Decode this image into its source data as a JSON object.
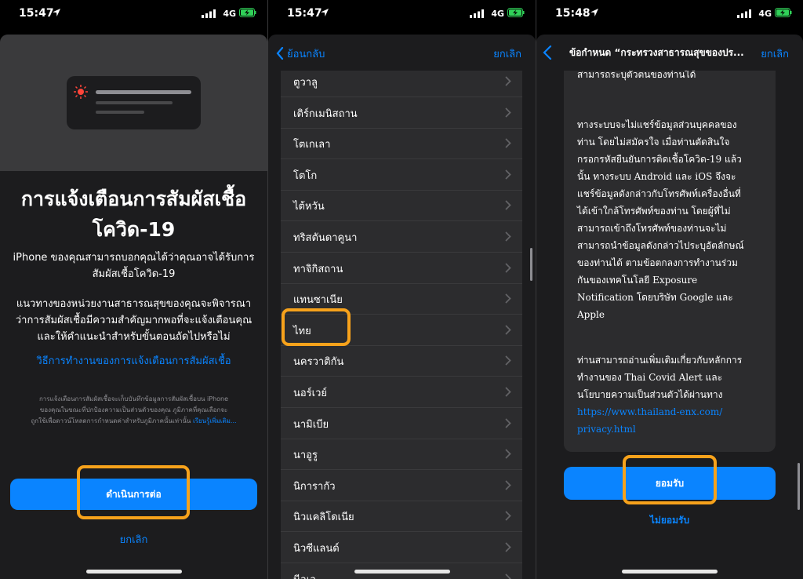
{
  "status": [
    {
      "time": "15:47",
      "network": "4G"
    },
    {
      "time": "15:47",
      "network": "4G"
    },
    {
      "time": "15:48",
      "network": "4G"
    }
  ],
  "panel1": {
    "title_line1": "การแจ้งเตือนการสัมผัสเชื้อ",
    "title_line2": "โควิด-19",
    "sub_line1": "iPhone ของคุณสามารถบอกคุณได้ว่าคุณอาจได้รับการ",
    "sub_line2": "สัมผัสเชื้อโควิด-19",
    "desc_line1": "แนวทางของหน่วยงานสาธารณสุขของคุณจะพิจารณา",
    "desc_line2": "ว่าการสัมผัสเชื้อมีความสำคัญมากพอที่จะแจ้งเตือนคุณ",
    "desc_line3": "และให้คำแนะนำสำหรับขั้นตอนถัดไปหรือไม่",
    "how_link": "วิธีการทำงานของการแจ้งเตือนการสัมผัสเชื้อ",
    "fine_line1": "การแจ้งเตือนการสัมผัสเชื้อจะเก็บบันทึกข้อมูลการสัมผัสเชื้อบน iPhone",
    "fine_line2": "ของคุณในขณะที่ปกป้องความเป็นส่วนตัวของคุณ ภูมิภาคที่คุณเลือกจะ",
    "fine_line3": "ถูกใช้เพื่อดาวน์โหลดการกำหนดค่าสำหรับภูมิภาคนั้นเท่านั้น",
    "fine_more": "เรียนรู้เพิ่มเติม...",
    "continue_button": "ดำเนินการต่อ",
    "cancel": "ยกเลิก"
  },
  "panel2": {
    "back": "ย้อนกลับ",
    "cancel": "ยกเลิก",
    "countries": [
      "ตูวาลู",
      "เติร์กเมนิสถาน",
      "โตเกเลา",
      "โตโก",
      "ไต้หวัน",
      "ทริสตันดาคูนา",
      "ทาจิกิสถาน",
      "แทนซาเนีย",
      "ไทย",
      "นครวาติกัน",
      "นอร์เวย์",
      "นามิเบีย",
      "นาอูรู",
      "นิการากัว",
      "นิวแคลิโดเนีย",
      "นิวซีแลนด์",
      "นีอูเอ"
    ],
    "selected": "ไทย"
  },
  "panel3": {
    "title": "ข้อกำหนด “กระทรวงสาธารณสุขของปร...",
    "cancel": "ยกเลิก",
    "para0": "สามารถระบุตัวตนของท่านได้",
    "para1": [
      "ทางระบบจะไม่แชร์ข้อมูลส่วนบุคคลของ",
      "ท่าน โดยไม่สมัครใจ เมื่อท่านตัดสินใจ",
      "กรอกรหัสยืนยันการติดเชื้อโควิด-19 แล้ว",
      "นั้น ทางระบบ Android และ iOS จึงจะ",
      "แชร์ข้อมูลดังกล่าวกับโทรศัพท์เครื่องอื่นที่",
      "ได้เข้าใกล้โทรศัพท์ของท่าน โดยผู้ที่ไม่",
      "สามารถเข้าถึงโทรศัพท์ของท่านจะไม่",
      "สามารถนำข้อมูลดังกล่าวไประบุอัตลักษณ์",
      "ของท่านได้ ตามข้อตกลงการทำงานร่วม",
      "กันของเทคโนโลยี Exposure",
      "Notification โดยบริษัท Google และ",
      "Apple"
    ],
    "para2": [
      "ท่านสามารถอ่านเพิ่มเติมเกี่ยวกับหลักการ",
      "ทำงานของ Thai Covid Alert และ",
      "นโยบายความเป็นส่วนตัวได้ผ่านทาง"
    ],
    "url_line1": "https://www.thailand-enx.com/",
    "url_line2": "privacy.html",
    "accept_button": "ยอมรับ",
    "decline": "ไม่ยอมรับ"
  },
  "colors": {
    "accent": "#0a84ff",
    "highlight": "#f7a21b",
    "sheet": "#1c1c1e",
    "battery": "#30d158"
  }
}
